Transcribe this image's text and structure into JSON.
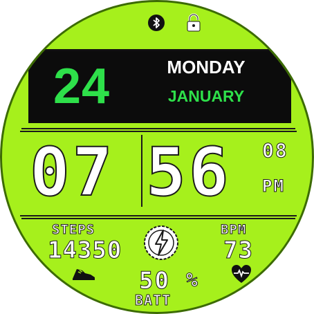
{
  "date": {
    "day": "24",
    "weekday": "MONDAY",
    "month": "JANUARY"
  },
  "time": {
    "hours": "07",
    "minutes": "56",
    "seconds": "08",
    "ampm": "PM"
  },
  "steps": {
    "label": "STEPS",
    "value": "14350"
  },
  "heart_rate": {
    "label": "BPM",
    "value": "73"
  },
  "battery": {
    "value": "50",
    "unit": "%",
    "label": "BATT"
  },
  "status_icons": [
    "bluetooth-icon",
    "lock-icon"
  ],
  "icons": [
    "shoe-icon",
    "lightning-bolt-icon",
    "heart-icon"
  ],
  "colors": {
    "face": "#a6f01c",
    "date_band": "#0c0c0c",
    "accent_green": "#2ee04a",
    "digit_fill": "#ffffff",
    "outline": "#1a1a1a"
  }
}
